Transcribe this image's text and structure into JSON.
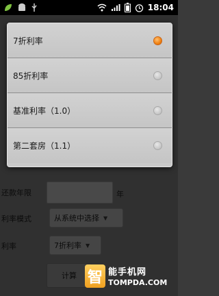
{
  "status_bar": {
    "time": "18:04",
    "icons": [
      "leaf-icon",
      "android-icon",
      "usb-icon",
      "wifi-icon",
      "signal-icon",
      "battery-icon",
      "alarm-icon"
    ]
  },
  "background_form": {
    "repay_years": {
      "label": "还款年限",
      "value": "",
      "unit": "年"
    },
    "rate_mode": {
      "label": "利率模式",
      "selected": "从系统中选择"
    },
    "rate": {
      "label": "利率",
      "selected": "7折利率"
    },
    "calculate_label": "计算"
  },
  "dialog": {
    "options": [
      {
        "label": "7折利率",
        "checked": true
      },
      {
        "label": "85折利率",
        "checked": false
      },
      {
        "label": "基准利率（1.0）",
        "checked": false
      },
      {
        "label": "第二套房（1.1）",
        "checked": false
      }
    ]
  },
  "watermark": {
    "logo_char": "智",
    "title": "能手机网",
    "url": "TOMPDA.COM"
  },
  "colors": {
    "accent_radio": "#f08010",
    "dialog_bg": "#c9c9c9",
    "statusbar_bg": "#000000"
  }
}
